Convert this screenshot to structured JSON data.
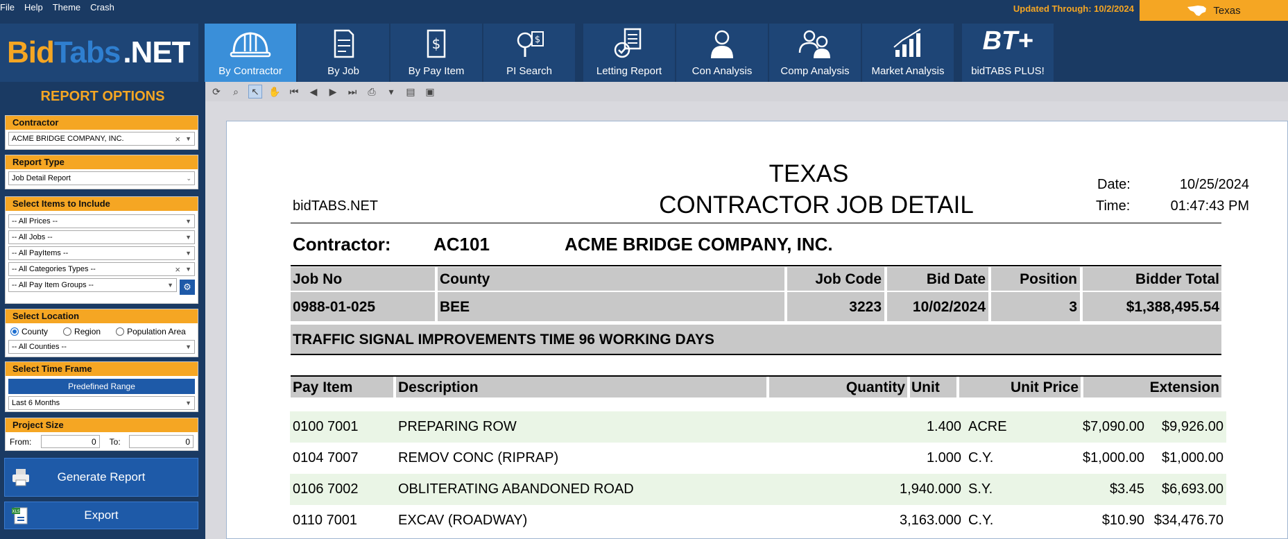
{
  "menu": [
    "File",
    "Help",
    "Theme",
    "Crash"
  ],
  "updated_through": "Updated Through: 10/2/2024",
  "state": "Texas",
  "logo": {
    "bid": "Bid",
    "tabs": "Tabs",
    "net": ".NET"
  },
  "nav_tabs": [
    {
      "label": "By Contractor",
      "icon": "hard-hat-icon",
      "active": true
    },
    {
      "label": "By Job",
      "icon": "blueprint-icon"
    },
    {
      "label": "By Pay Item",
      "icon": "dollar-document-icon"
    },
    {
      "label": "PI Search",
      "icon": "search-dollar-icon"
    },
    {
      "label": "Letting Report",
      "icon": "report-check-icon"
    },
    {
      "label": "Con Analysis",
      "icon": "person-icon"
    },
    {
      "label": "Comp Analysis",
      "icon": "two-persons-icon"
    },
    {
      "label": "Market Analysis",
      "icon": "bar-chart-icon"
    },
    {
      "label": "bidTABS PLUS!",
      "icon_text": "BT+"
    }
  ],
  "sidebar": {
    "title": "REPORT OPTIONS",
    "contractor": {
      "header": "Contractor",
      "value": "ACME BRIDGE COMPANY, INC."
    },
    "report_type": {
      "header": "Report Type",
      "value": "Job Detail Report"
    },
    "items": {
      "header": "Select Items to Include",
      "prices": "-- All Prices --",
      "jobs": "-- All Jobs --",
      "payitems": "-- All PayItems --",
      "categories": "-- All Categories Types --",
      "groups": "-- All Pay Item Groups --"
    },
    "location": {
      "header": "Select Location",
      "county": "County",
      "region": "Region",
      "population": "Population Area",
      "counties": "-- All Counties --"
    },
    "timeframe": {
      "header": "Select Time Frame",
      "predefined": "Predefined Range",
      "range": "Last 6 Months"
    },
    "project_size": {
      "header": "Project Size",
      "from_label": "From:",
      "from": "0",
      "to_label": "To:",
      "to": "0"
    },
    "generate": "Generate Report",
    "export": "Export"
  },
  "report": {
    "state": "TEXAS",
    "title": "CONTRACTOR JOB DETAIL",
    "brand": "bidTABS.NET",
    "date_label": "Date:",
    "date": "10/25/2024",
    "time_label": "Time:",
    "time": "01:47:43 PM",
    "contractor_label": "Contractor:",
    "contractor_code": "AC101",
    "contractor_name": "ACME BRIDGE COMPANY, INC.",
    "job_headers": {
      "job_no": "Job No",
      "county": "County",
      "job_code": "Job Code",
      "bid_date": "Bid Date",
      "position": "Position",
      "bidder_total": "Bidder Total"
    },
    "job": {
      "job_no": "0988-01-025",
      "county": "BEE",
      "job_code": "3223",
      "bid_date": "10/02/2024",
      "position": "3",
      "bidder_total": "$1,388,495.54"
    },
    "job_description": "TRAFFIC SIGNAL IMPROVEMENTS TIME  96 WORKING DAYS",
    "item_headers": {
      "pay_item": "Pay Item",
      "description": "Description",
      "quantity": "Quantity",
      "unit": "Unit",
      "unit_price": "Unit Price",
      "extension": "Extension"
    },
    "items": [
      {
        "pay_item": "0100 7001",
        "description": "PREPARING ROW",
        "quantity": "1.400",
        "unit": "ACRE",
        "unit_price": "$7,090.00",
        "extension": "$9,926.00"
      },
      {
        "pay_item": "0104 7007",
        "description": "REMOV CONC (RIPRAP)",
        "quantity": "1.000",
        "unit": "C.Y.",
        "unit_price": "$1,000.00",
        "extension": "$1,000.00"
      },
      {
        "pay_item": "0106 7002",
        "description": "OBLITERATING ABANDONED ROAD",
        "quantity": "1,940.000",
        "unit": "S.Y.",
        "unit_price": "$3.45",
        "extension": "$6,693.00"
      },
      {
        "pay_item": "0110 7001",
        "description": "EXCAV (ROADWAY)",
        "quantity": "3,163.000",
        "unit": "C.Y.",
        "unit_price": "$10.90",
        "extension": "$34,476.70"
      }
    ]
  }
}
